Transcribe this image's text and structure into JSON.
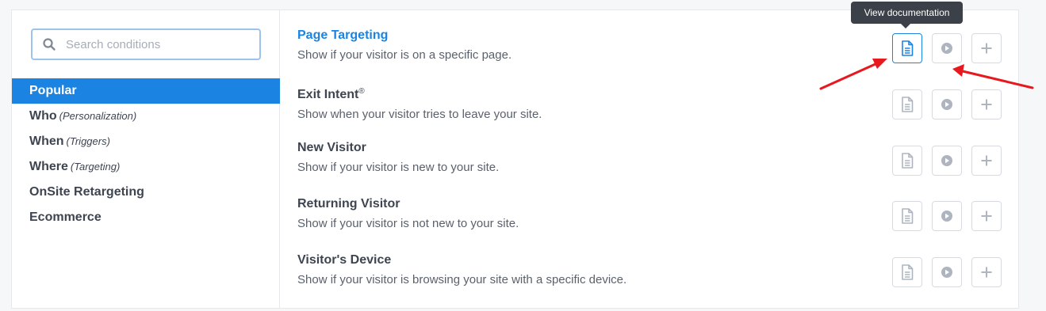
{
  "search": {
    "placeholder": "Search conditions",
    "value": ""
  },
  "sidebar": {
    "items": [
      {
        "label": "Popular",
        "sub": "",
        "active": true
      },
      {
        "label": "Who",
        "sub": "(Personalization)",
        "active": false
      },
      {
        "label": "When",
        "sub": "(Triggers)",
        "active": false
      },
      {
        "label": "Where",
        "sub": "(Targeting)",
        "active": false
      },
      {
        "label": "OnSite Retargeting",
        "sub": "",
        "active": false
      },
      {
        "label": "Ecommerce",
        "sub": "",
        "active": false
      }
    ]
  },
  "conditions": [
    {
      "title": "Page Targeting",
      "mark": "",
      "description": "Show if your visitor is on a specific page.",
      "highlighted": true
    },
    {
      "title": "Exit Intent",
      "mark": "®",
      "description": "Show when your visitor tries to leave your site.",
      "highlighted": false
    },
    {
      "title": "New Visitor",
      "mark": "",
      "description": "Show if your visitor is new to your site.",
      "highlighted": false
    },
    {
      "title": "Returning Visitor",
      "mark": "",
      "description": "Show if your visitor is not new to your site.",
      "highlighted": false
    },
    {
      "title": "Visitor's Device",
      "mark": "",
      "description": "Show if your visitor is browsing your site with a specific device.",
      "highlighted": false
    }
  ],
  "tooltip": {
    "text": "View documentation"
  },
  "icons": {
    "search": "search-icon",
    "documentation": "document-icon",
    "video": "play-icon",
    "add": "plus-icon"
  },
  "colors": {
    "accent": "#1b84e2",
    "text": "#3e4551",
    "muted_icon": "#aeb5c0",
    "tooltip_bg": "#3c4048",
    "annotation_arrow": "#e8191e"
  }
}
